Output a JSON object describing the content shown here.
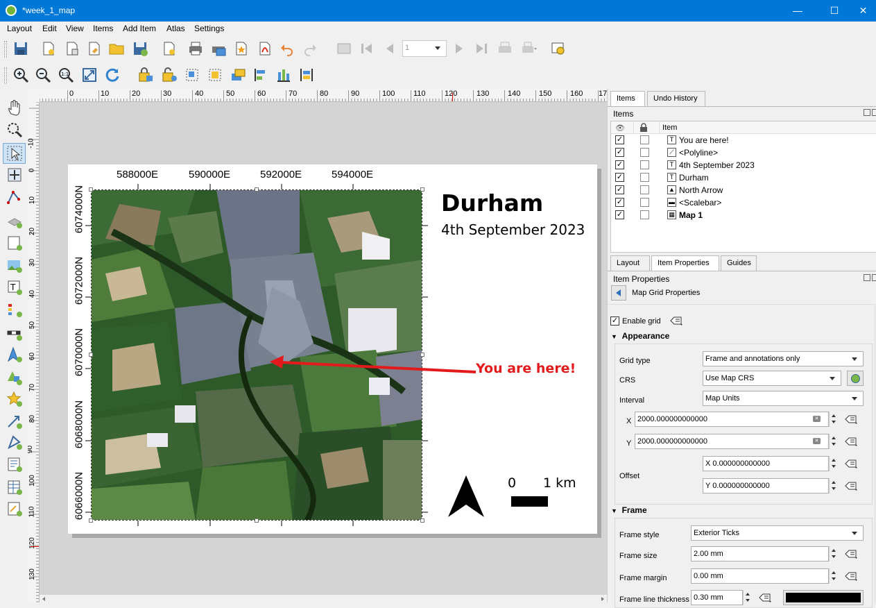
{
  "window": {
    "title": "*week_1_map",
    "minimize": "—",
    "maximize": "☐",
    "close": "✕"
  },
  "menu": [
    "Layout",
    "Edit",
    "View",
    "Items",
    "Add Item",
    "Atlas",
    "Settings"
  ],
  "atlas": {
    "page_value": "1"
  },
  "ruler_h": [
    "0",
    "10",
    "20",
    "30",
    "40",
    "50",
    "60",
    "70",
    "80",
    "90",
    "100",
    "110",
    "120",
    "130",
    "140",
    "150",
    "160",
    "17"
  ],
  "ruler_v": [
    "-10",
    "0",
    "10",
    "20",
    "30",
    "40",
    "50",
    "60",
    "70",
    "80",
    "90",
    "100",
    "110",
    "120",
    "130"
  ],
  "map": {
    "grid_x": [
      "588000E",
      "590000E",
      "592000E",
      "594000E"
    ],
    "grid_y": [
      "6074000N",
      "6072000N",
      "6070000N",
      "6068000N",
      "6066000N"
    ],
    "title": "Durham",
    "date": "4th September 2023",
    "annotation": "You are here!",
    "scale_0": "0",
    "scale_1": "1 km",
    "colors": {
      "annotation": "#e31a1c",
      "arrow": "#e31a1c"
    }
  },
  "panel": {
    "top_tabs": [
      "Items",
      "Undo History"
    ],
    "items_label": "Items",
    "col_item": "Item",
    "items": [
      {
        "label": "You are here!",
        "icon": "T",
        "bold": false
      },
      {
        "label": "<Polyline>",
        "icon": "⟋",
        "bold": false
      },
      {
        "label": "4th September 2023",
        "icon": "T",
        "bold": false
      },
      {
        "label": "Durham",
        "icon": "T",
        "bold": false
      },
      {
        "label": "North Arrow",
        "icon": "▲",
        "bold": false
      },
      {
        "label": "<Scalebar>",
        "icon": "▬",
        "bold": false
      },
      {
        "label": "Map 1",
        "icon": "▦",
        "bold": true
      }
    ],
    "bottom_tabs": [
      "Layout",
      "Item Properties",
      "Guides"
    ],
    "item_properties_label": "Item Properties",
    "back_label": "Map Grid Properties",
    "enable_grid": "Enable grid",
    "appearance": "Appearance",
    "grid_type_label": "Grid type",
    "grid_type_value": "Frame and annotations only",
    "crs_label": "CRS",
    "crs_value": "Use Map CRS",
    "interval_label": "Interval",
    "interval_value": "Map Units",
    "x_label": "X",
    "x_value": "2000.000000000000",
    "y_label": "Y",
    "y_value": "2000.000000000000",
    "offset_label": "Offset",
    "offset_x": "X 0.000000000000",
    "offset_y": "Y 0.000000000000",
    "frame": "Frame",
    "frame_style_label": "Frame style",
    "frame_style_value": "Exterior Ticks",
    "frame_size_label": "Frame size",
    "frame_size_value": "2.00 mm",
    "frame_margin_label": "Frame margin",
    "frame_margin_value": "0.00 mm",
    "frame_line_label": "Frame line thickness",
    "frame_line_value": "0.30 mm"
  }
}
